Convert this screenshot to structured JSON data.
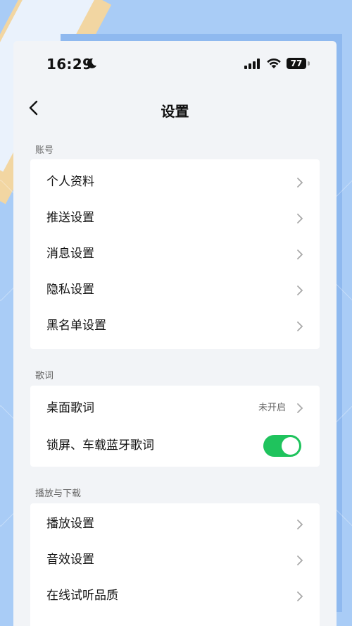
{
  "status_bar": {
    "time": "16:29",
    "battery": "77",
    "icons": [
      "moon-icon",
      "signal-icon",
      "wifi-icon",
      "battery-icon"
    ]
  },
  "header": {
    "title": "设置"
  },
  "sections": [
    {
      "label": "账号",
      "rows": [
        {
          "label": "个人资料"
        },
        {
          "label": "推送设置"
        },
        {
          "label": "消息设置"
        },
        {
          "label": "隐私设置"
        },
        {
          "label": "黑名单设置"
        }
      ]
    },
    {
      "label": "歌词",
      "rows": [
        {
          "label": "桌面歌词",
          "value": "未开启"
        },
        {
          "label": "锁屏、车载蓝牙歌词",
          "toggle": true
        }
      ]
    },
    {
      "label": "播放与下载",
      "rows": [
        {
          "label": "播放设置"
        },
        {
          "label": "音效设置"
        },
        {
          "label": "在线试听品质"
        }
      ]
    }
  ],
  "colors": {
    "toggle_on": "#1fc35d",
    "page_bg": "#f2f4f7",
    "backdrop": "#a9ccf6"
  }
}
